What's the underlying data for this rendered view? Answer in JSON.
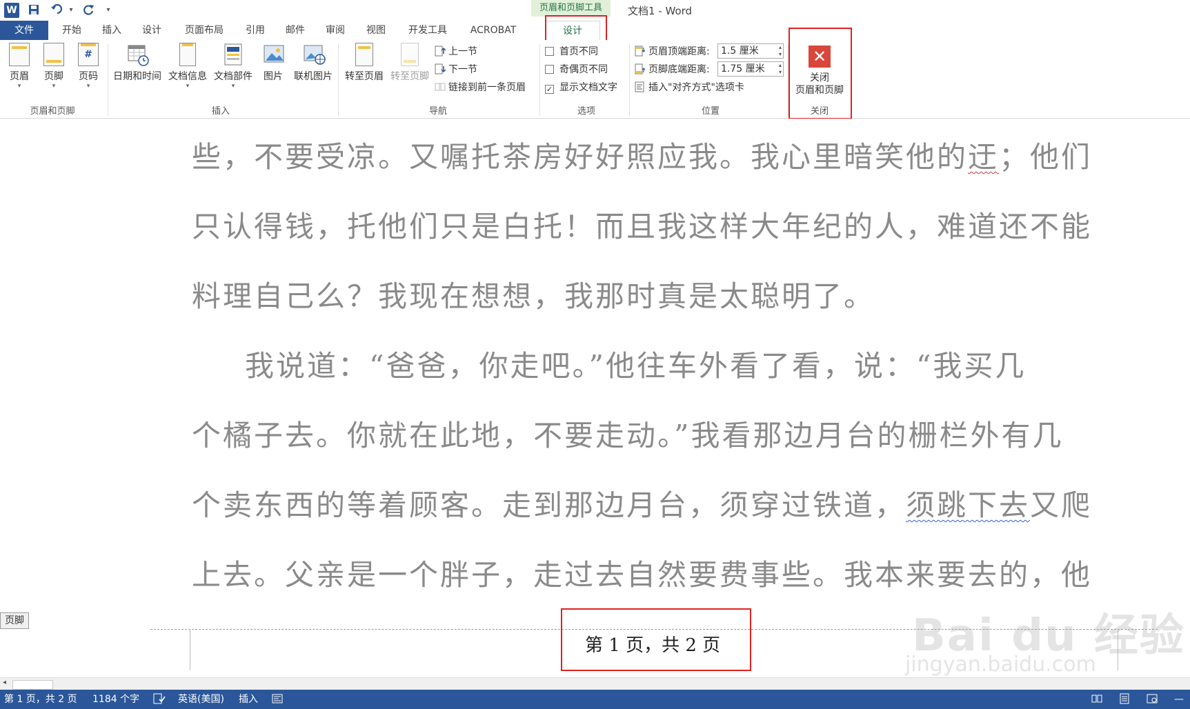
{
  "qat": {
    "logo": "W",
    "save_icon": "save-icon",
    "undo_icon": "undo-icon",
    "redo_icon": "redo-icon",
    "more": "▾"
  },
  "context_tab_header": "页眉和页脚工具",
  "window_title": "文档1 - Word",
  "tabs": {
    "file": "文件",
    "home": "开始",
    "insert": "插入",
    "design": "设计",
    "layout": "页面布局",
    "references": "引用",
    "mailings": "邮件",
    "review": "审阅",
    "view": "视图",
    "developer": "开发工具",
    "acrobat": "ACROBAT",
    "hf_design": "设计"
  },
  "ribbon": {
    "group_hf": {
      "label": "页眉和页脚",
      "header": "页眉",
      "footer": "页脚",
      "page_number": "页码"
    },
    "group_insert": {
      "label": "插入",
      "datetime": "日期和时间",
      "docinfo": "文档信息",
      "quickparts": "文档部件",
      "picture": "图片",
      "online_picture": "联机图片"
    },
    "group_nav": {
      "label": "导航",
      "goto_header": "转至页眉",
      "goto_footer": "转至页脚",
      "prev": "上一节",
      "next": "下一节",
      "link_prev": "链接到前一条页眉"
    },
    "group_options": {
      "label": "选项",
      "diff_first": "首页不同",
      "diff_odd_even": "奇偶页不同",
      "show_doc_text": "显示文档文字",
      "show_doc_text_checked": "✓"
    },
    "group_position": {
      "label": "位置",
      "header_top": "页眉顶端距离:",
      "header_top_value": "1.5 厘米",
      "footer_bottom": "页脚底端距离:",
      "footer_bottom_value": "1.75 厘米",
      "insert_align_tab": "插入\"对齐方式\"选项卡"
    },
    "group_close": {
      "label": "关闭",
      "close_btn_line1": "关闭",
      "close_btn_line2": "页眉和页脚",
      "close_glyph": "✕"
    }
  },
  "document": {
    "lines": [
      "些，不要受凉。又嘱托茶房好好照应我。我心里暗笑他的迂；他们",
      "只认得钱，托他们只是白托！而且我这样大年纪的人，难道还不能",
      "料理自己么？我现在想想，我那时真是太聪明了。",
      "我说道：“爸爸，你走吧。”他往车外看了看，说：“我买几",
      "个橘子去。你就在此地，不要走动。”我看那边月台的栅栏外有几",
      "个卖东西的等着顾客。走到那边月台，须穿过铁道，须跳下去又爬",
      "上去。父亲是一个胖子，走过去自然要费事些。我本来要去的，他"
    ],
    "line1_pre": "些，不要受凉。又嘱托茶房好好照应我。我心里暗笑他的",
    "line1_mark": "迂",
    "line1_post": "；他们",
    "line6_pre": "个卖东西的等着顾客。走到那边月台，须穿过铁道，",
    "line6_mark": "须跳下去",
    "line6_post": "又爬",
    "footer_tag": "页脚",
    "footer_text": "第 1 页，共 2 页"
  },
  "watermark": {
    "line1": "Bai du 经验",
    "line2": "jingyan.baidu.com"
  },
  "status": {
    "page": "第 1 页，共 2 页",
    "words": "1184 个字",
    "language": "英语(美国)",
    "mode": "插入"
  }
}
